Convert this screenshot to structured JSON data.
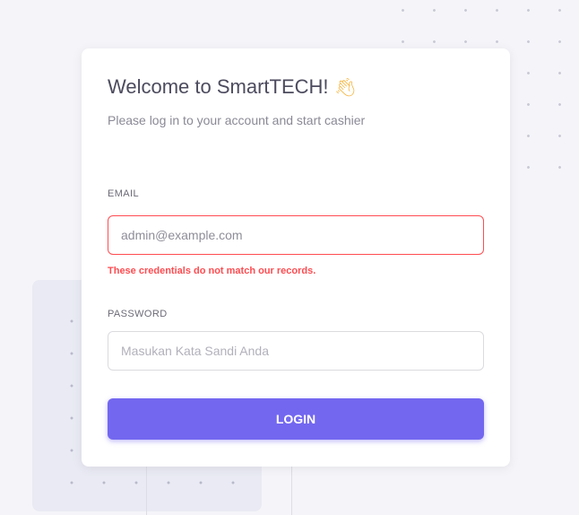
{
  "login": {
    "title": "Welcome to SmartTECH!",
    "title_icon": "waving-hand-icon",
    "subtitle": "Please log in to your account and start cashier",
    "email_label": "EMAIL",
    "email_value": "admin@example.com",
    "email_error": "These credentials do not match our records.",
    "password_label": "PASSWORD",
    "password_placeholder": "Masukan Kata Sandi Anda",
    "login_button": "LOGIN"
  },
  "colors": {
    "accent": "#7367f0",
    "error": "#ff4c51",
    "background": "#f5f5f9"
  }
}
